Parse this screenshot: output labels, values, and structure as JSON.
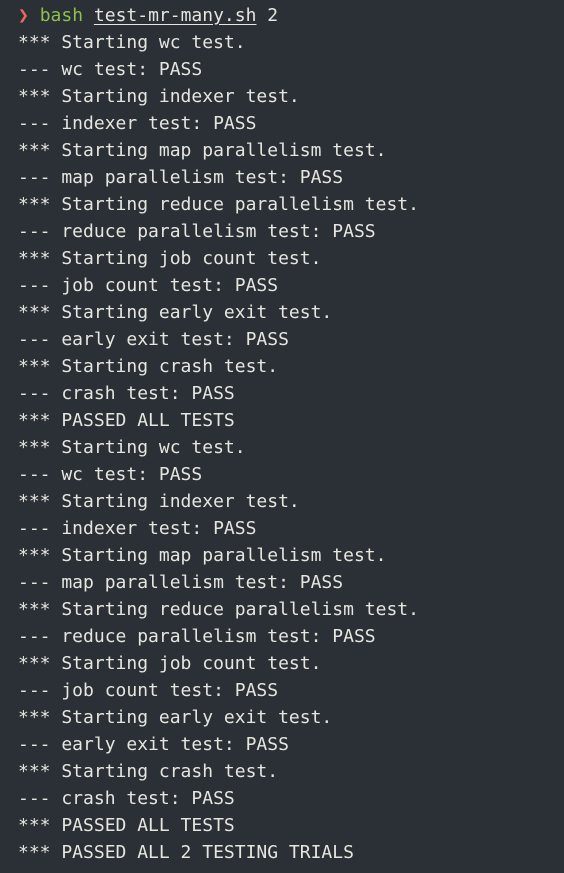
{
  "prompt": {
    "symbol": "❯",
    "command": "bash",
    "script": "test-mr-many.sh",
    "argument": "2"
  },
  "colors": {
    "background": "#2b3037",
    "text": "#e6e6df",
    "prompt_symbol": "#ef6a56",
    "command": "#8fbf4f"
  },
  "output": [
    "*** Starting wc test.",
    "--- wc test: PASS",
    "*** Starting indexer test.",
    "--- indexer test: PASS",
    "*** Starting map parallelism test.",
    "--- map parallelism test: PASS",
    "*** Starting reduce parallelism test.",
    "--- reduce parallelism test: PASS",
    "*** Starting job count test.",
    "--- job count test: PASS",
    "*** Starting early exit test.",
    "--- early exit test: PASS",
    "*** Starting crash test.",
    "--- crash test: PASS",
    "*** PASSED ALL TESTS",
    "*** Starting wc test.",
    "--- wc test: PASS",
    "*** Starting indexer test.",
    "--- indexer test: PASS",
    "*** Starting map parallelism test.",
    "--- map parallelism test: PASS",
    "*** Starting reduce parallelism test.",
    "--- reduce parallelism test: PASS",
    "*** Starting job count test.",
    "--- job count test: PASS",
    "*** Starting early exit test.",
    "--- early exit test: PASS",
    "*** Starting crash test.",
    "--- crash test: PASS",
    "*** PASSED ALL TESTS",
    "*** PASSED ALL 2 TESTING TRIALS"
  ]
}
